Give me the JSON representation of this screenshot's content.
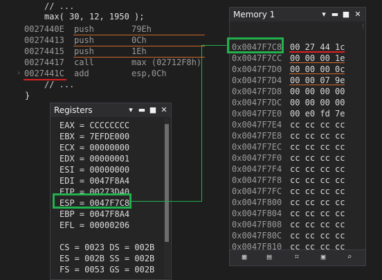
{
  "code": {
    "comment_top": "// ...",
    "call_line": "max( 30, 12, 1950 );",
    "comment_bottom": "// ...",
    "closing_brace": "}",
    "disasm": [
      {
        "addr": "0027440E",
        "op": "push",
        "arg": "79Eh"
      },
      {
        "addr": "00274413",
        "op": "push",
        "arg": "0Ch"
      },
      {
        "addr": "00274415",
        "op": "push",
        "arg": "1Eh"
      },
      {
        "addr": "00274417",
        "op": "call",
        "arg": "max (02712F8h)"
      },
      {
        "addr": "0027441C",
        "op": "add",
        "arg": "esp,0Ch"
      }
    ]
  },
  "memory": {
    "title": "Memory 1",
    "rows": [
      {
        "addr": "0x0047F7C8",
        "bytes": "00 27 44 1c"
      },
      {
        "addr": "0x0047F7CC",
        "bytes": "00 00 00 1e"
      },
      {
        "addr": "0x0047F7D0",
        "bytes": "00 00 00 0c"
      },
      {
        "addr": "0x0047F7D4",
        "bytes": "00 00 07 9e"
      },
      {
        "addr": "0x0047F7D8",
        "bytes": "00 00 00 00"
      },
      {
        "addr": "0x0047F7DC",
        "bytes": "00 00 00 00"
      },
      {
        "addr": "0x0047F7E0",
        "bytes": "00 e0 fd 7e"
      },
      {
        "addr": "0x0047F7E4",
        "bytes": "cc cc cc cc"
      },
      {
        "addr": "0x0047F7E8",
        "bytes": "cc cc cc cc"
      },
      {
        "addr": "0x0047F7EC",
        "bytes": "cc cc cc cc"
      },
      {
        "addr": "0x0047F7F0",
        "bytes": "cc cc cc cc"
      },
      {
        "addr": "0x0047F7F4",
        "bytes": "cc cc cc cc"
      },
      {
        "addr": "0x0047F7F8",
        "bytes": "cc cc cc cc"
      },
      {
        "addr": "0x0047F7FC",
        "bytes": "cc cc cc cc"
      },
      {
        "addr": "0x0047F800",
        "bytes": "cc cc cc cc"
      },
      {
        "addr": "0x0047F804",
        "bytes": "cc cc cc cc"
      },
      {
        "addr": "0x0047F808",
        "bytes": "cc cc cc cc"
      },
      {
        "addr": "0x0047F80C",
        "bytes": "cc cc cc cc"
      },
      {
        "addr": "0x0047F810",
        "bytes": "cc cc cc cc"
      }
    ]
  },
  "registers": {
    "title": "Registers",
    "rows": [
      "EAX = CCCCCCCC",
      "EBX = 7EFDE000",
      "ECX = 00000000",
      "EDX = 00000001",
      "ESI = 00000000",
      "EDI = 0047F8A4",
      "EIP = 00273D40",
      "ESP = 0047F7C8",
      "EBP = 0047F8A4",
      "EFL = 00000206",
      "",
      "CS = 0023 DS = 002B",
      "ES = 002B SS = 002B",
      "FS = 0053 GS = 002B"
    ]
  },
  "colors": {
    "highlight_green": "#22b14c",
    "underline_red": "#e02020",
    "underline_orange": "#d06a28"
  },
  "icons": [
    "dropdown-arrow-icon",
    "pin-icon",
    "maximize-icon",
    "close-icon"
  ]
}
